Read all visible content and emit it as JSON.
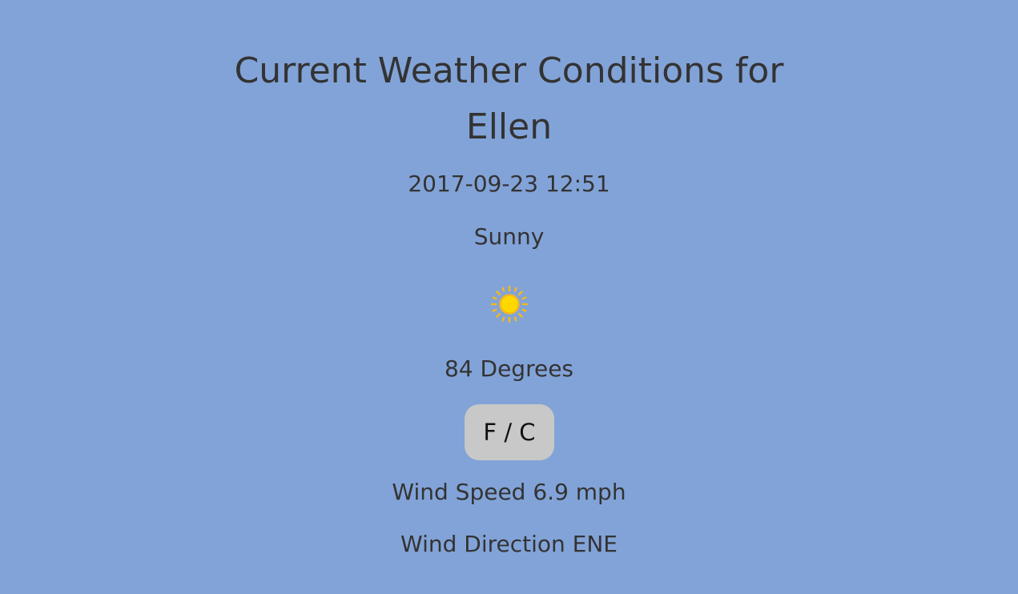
{
  "header": {
    "title_line1": "Current Weather Conditions for",
    "title_line2": "Ellen"
  },
  "weather": {
    "datetime": "2017-09-23 12:51",
    "condition": "Sunny",
    "icon": "sun-icon",
    "temperature": "84 Degrees",
    "unit_toggle_label": "F / C",
    "wind_speed": "Wind Speed 6.9 mph",
    "wind_direction": "Wind Direction ENE"
  },
  "colors": {
    "background": "#82a3d8",
    "text": "#333333",
    "button_background": "#c8c8c8",
    "sun_fill": "#ffd800",
    "sun_ring": "#f5b81c"
  }
}
